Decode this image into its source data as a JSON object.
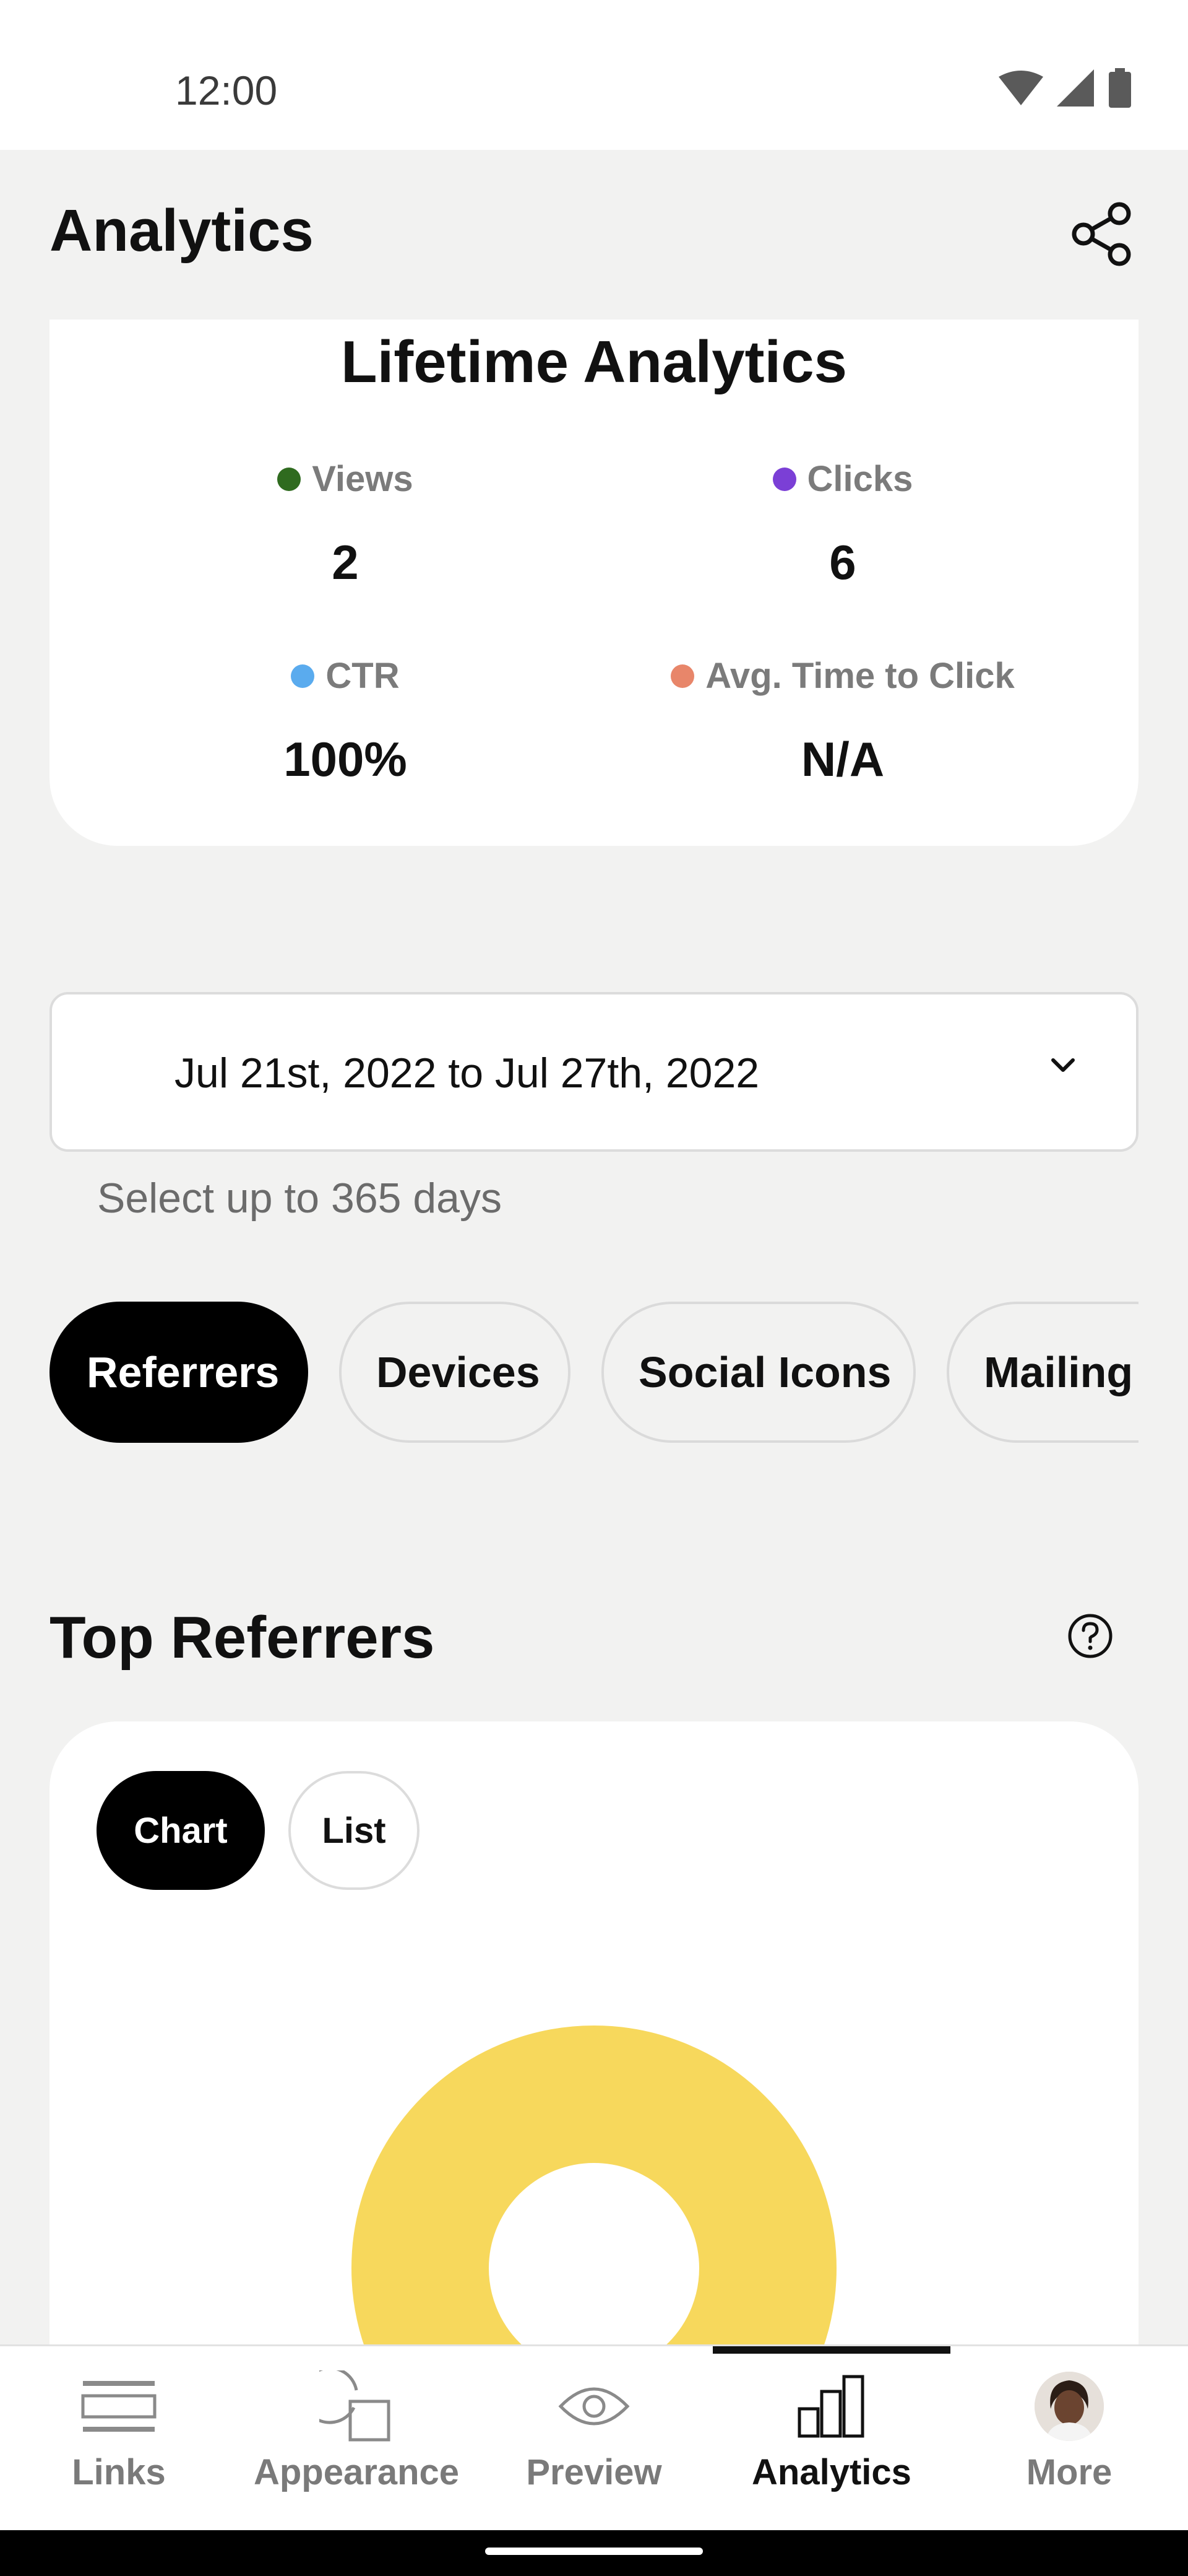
{
  "status_bar": {
    "time": "12:00"
  },
  "header": {
    "title": "Analytics"
  },
  "lifetime": {
    "title": "Lifetime Analytics",
    "stats": [
      {
        "label": "Views",
        "value": "2",
        "color": "#2f6b1f"
      },
      {
        "label": "Clicks",
        "value": "6",
        "color": "#7b3fd6"
      },
      {
        "label": "CTR",
        "value": "100%",
        "color": "#5aabee"
      },
      {
        "label": "Avg. Time to Click",
        "value": "N/A",
        "color": "#e8866a"
      }
    ]
  },
  "date_range": {
    "value": "Jul 21st, 2022 to Jul 27th, 2022",
    "hint": "Select up to 365 days"
  },
  "tabs": [
    "Referrers",
    "Devices",
    "Social Icons",
    "Mailing"
  ],
  "section": {
    "title": "Top Referrers"
  },
  "view_toggle": {
    "chart": "Chart",
    "list": "List"
  },
  "chart_colors": {
    "donut": "#f7d85c"
  },
  "bottom_nav": {
    "items": [
      {
        "label": "Links"
      },
      {
        "label": "Appearance"
      },
      {
        "label": "Preview"
      },
      {
        "label": "Analytics"
      },
      {
        "label": "More"
      }
    ],
    "active": "Analytics"
  }
}
